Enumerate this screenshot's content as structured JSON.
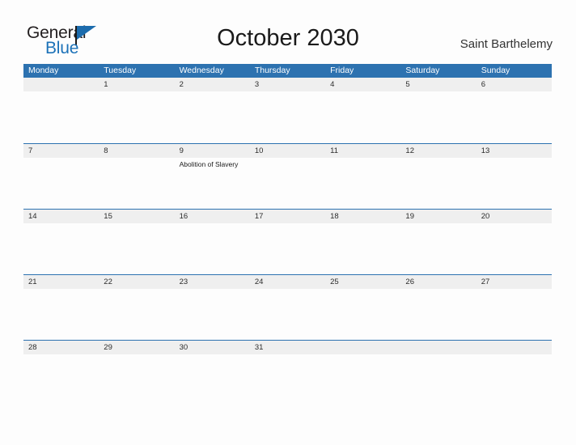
{
  "logo": {
    "word_one": "General",
    "word_two": "Blue",
    "flag_icon": "flag-icon",
    "accent_color": "#1c72b8"
  },
  "header": {
    "title": "October 2030",
    "location": "Saint Barthelemy"
  },
  "theme": {
    "header_blue": "#2d72b0",
    "band_gray": "#efefef",
    "page_background": "#fdfdfd",
    "text_color": "#2b2b2b"
  },
  "calendar": {
    "weekdays": [
      "Monday",
      "Tuesday",
      "Wednesday",
      "Thursday",
      "Friday",
      "Saturday",
      "Sunday"
    ],
    "weeks": [
      [
        {
          "date": "",
          "events": []
        },
        {
          "date": "1",
          "events": []
        },
        {
          "date": "2",
          "events": []
        },
        {
          "date": "3",
          "events": []
        },
        {
          "date": "4",
          "events": []
        },
        {
          "date": "5",
          "events": []
        },
        {
          "date": "6",
          "events": []
        }
      ],
      [
        {
          "date": "7",
          "events": []
        },
        {
          "date": "8",
          "events": []
        },
        {
          "date": "9",
          "events": [
            "Abolition of Slavery"
          ]
        },
        {
          "date": "10",
          "events": []
        },
        {
          "date": "11",
          "events": []
        },
        {
          "date": "12",
          "events": []
        },
        {
          "date": "13",
          "events": []
        }
      ],
      [
        {
          "date": "14",
          "events": []
        },
        {
          "date": "15",
          "events": []
        },
        {
          "date": "16",
          "events": []
        },
        {
          "date": "17",
          "events": []
        },
        {
          "date": "18",
          "events": []
        },
        {
          "date": "19",
          "events": []
        },
        {
          "date": "20",
          "events": []
        }
      ],
      [
        {
          "date": "21",
          "events": []
        },
        {
          "date": "22",
          "events": []
        },
        {
          "date": "23",
          "events": []
        },
        {
          "date": "24",
          "events": []
        },
        {
          "date": "25",
          "events": []
        },
        {
          "date": "26",
          "events": []
        },
        {
          "date": "27",
          "events": []
        }
      ],
      [
        {
          "date": "28",
          "events": []
        },
        {
          "date": "29",
          "events": []
        },
        {
          "date": "30",
          "events": []
        },
        {
          "date": "31",
          "events": []
        },
        {
          "date": "",
          "events": []
        },
        {
          "date": "",
          "events": []
        },
        {
          "date": "",
          "events": []
        }
      ]
    ]
  }
}
